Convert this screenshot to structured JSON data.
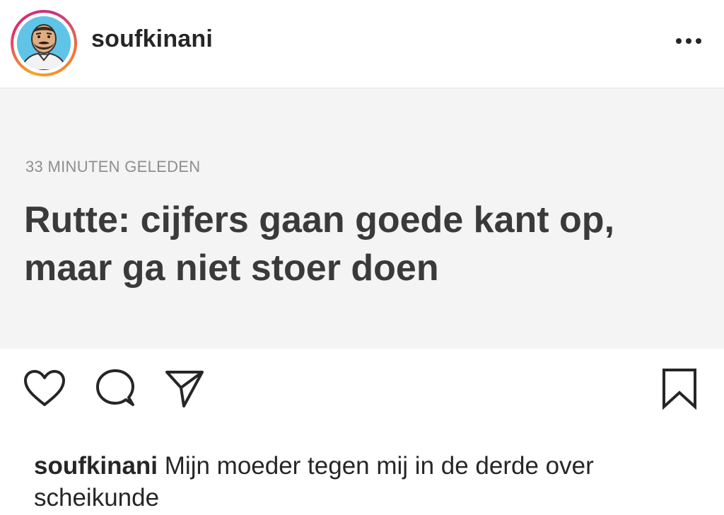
{
  "header": {
    "username": "soufkinani",
    "more_icon": "ellipsis-icon"
  },
  "post": {
    "timestamp": "33 MINUTEN GELEDEN",
    "headline": "Rutte: cijfers gaan goede kant op, maar ga niet stoer doen",
    "background": "#f4f4f4"
  },
  "actions": {
    "like_icon": "heart-icon",
    "comment_icon": "comment-icon",
    "share_icon": "paper-plane-icon",
    "save_icon": "bookmark-icon"
  },
  "caption": {
    "username": "soufkinani",
    "text": "Mijn moeder tegen mij in de derde over scheikunde"
  }
}
